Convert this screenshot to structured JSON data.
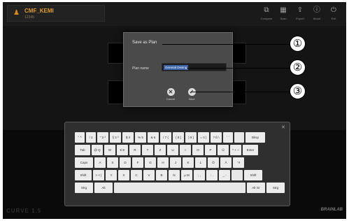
{
  "patient": {
    "name": "CMF_KEMI",
    "id": "12345",
    "icon": "patient-icon"
  },
  "toolbar": [
    {
      "name": "toolbar-compare",
      "label": "Compare",
      "icon": "compare-icon",
      "glyph": "⧉"
    },
    {
      "name": "toolbar-scan",
      "label": "Scan",
      "icon": "scan-icon",
      "glyph": "▦"
    },
    {
      "name": "toolbar-export",
      "label": "Export",
      "icon": "export-icon",
      "glyph": "⇪"
    },
    {
      "name": "toolbar-about",
      "label": "About",
      "icon": "info-icon",
      "glyph": "ⓘ"
    },
    {
      "name": "toolbar-exit",
      "label": "Exit",
      "icon": "power-icon",
      "glyph": "⏻"
    }
  ],
  "dialog": {
    "title": "Save as Plan",
    "field_label": "Plan name",
    "field_value": "General Desing",
    "cancel_label": "Cancel",
    "save_label": "Save"
  },
  "callouts": [
    "①",
    "②",
    "③"
  ],
  "keyboard": {
    "close": "✕",
    "rows": [
      [
        "° ^",
        "! 1",
        "\" 2 ²",
        "§ 3 ³",
        "$ 4",
        "% 5",
        "& 6",
        "/ 7 {",
        "( 8 [",
        ") 9 ]",
        "= 0 }",
        "? ß \\",
        "` ´",
        "",
        "Bksp"
      ],
      [
        "Tab",
        "@ Q",
        "W",
        "€ E",
        "R",
        "T",
        "Z",
        "U",
        "I",
        "O",
        "P",
        "Ü",
        "* + ~",
        "Enter"
      ],
      [
        "Caps",
        "A",
        "S",
        "D",
        "F",
        "G",
        "H",
        "J",
        "K",
        "L",
        "Ö",
        "Ä",
        "' #"
      ],
      [
        "Shift",
        "> < |",
        "Y",
        "X",
        "C",
        "V",
        "B",
        "N",
        "µ M",
        "; ,",
        ": .",
        "_ -",
        "",
        "Shift"
      ],
      [
        "Strg",
        "Alt",
        "",
        "Alt Gr",
        "Strg"
      ]
    ]
  },
  "brand": "CURVE 1.5",
  "logo": "BRAINLAB"
}
